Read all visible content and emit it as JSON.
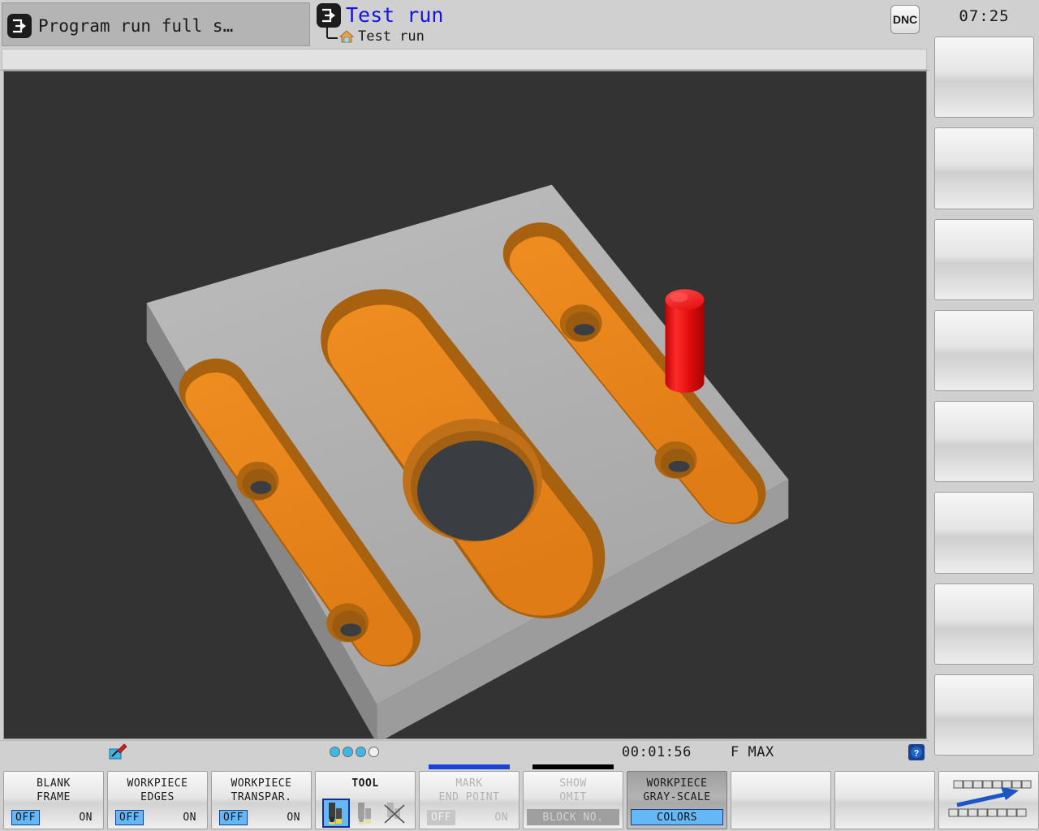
{
  "header": {
    "inactive_tab": {
      "label": "Program run full s…",
      "icon": "mode-enter-icon"
    },
    "active_tab": {
      "label": "Test run",
      "sub_label": "Test run",
      "icon": "mode-enter-icon",
      "sub_icon": "home-icon"
    },
    "dnc_button": "DNC",
    "accent_blue": "#1414e6"
  },
  "clock": {
    "time": "07:25"
  },
  "right_softkeys": [
    {
      "label": "",
      "name": "vertical-softkey-1"
    },
    {
      "label": "",
      "name": "vertical-softkey-2"
    },
    {
      "label": "",
      "name": "vertical-softkey-3"
    },
    {
      "label": "",
      "name": "vertical-softkey-4"
    },
    {
      "label": "",
      "name": "vertical-softkey-5"
    },
    {
      "label": "",
      "name": "vertical-softkey-6"
    },
    {
      "label": "",
      "name": "vertical-softkey-7"
    },
    {
      "label": "",
      "name": "vertical-softkey-8"
    }
  ],
  "graphics": {
    "background_color": "#333333",
    "workpiece_top_color": "#b8b8b8",
    "pocket_color": "#e8871e",
    "pocket_shadow_color": "#b3641a",
    "tool_color": "#e81010",
    "hole_color": "#3a3d42",
    "description": "3D simulated workpiece with three milled slots, drilled holes, central bore and red cylindrical tool"
  },
  "statusbar": {
    "pen_icon": "graphics-pen-icon",
    "dots": [
      "on",
      "on",
      "on",
      "off"
    ],
    "timer": "00:01:56",
    "feed": "F MAX",
    "help_icon": "help-icon"
  },
  "bottom_softkeys": [
    {
      "name": "blank-frame",
      "line1": "BLANK",
      "line2": "FRAME",
      "toggle": {
        "off": "OFF",
        "on": "ON",
        "selected": "off"
      },
      "disabled": false,
      "pressed": false,
      "topbar": "none"
    },
    {
      "name": "workpiece-edges",
      "line1": "WORKPIECE",
      "line2": "EDGES",
      "toggle": {
        "off": "OFF",
        "on": "ON",
        "selected": "off"
      },
      "disabled": false,
      "pressed": false,
      "topbar": "none"
    },
    {
      "name": "workpiece-transparency",
      "line1": "WORKPIECE",
      "line2": "TRANSPAR.",
      "toggle": {
        "off": "OFF",
        "on": "ON",
        "selected": "off"
      },
      "disabled": false,
      "pressed": false,
      "topbar": "none"
    },
    {
      "name": "tool",
      "line1": "TOOL",
      "line2": "",
      "icons": [
        "tool-solid-icon",
        "tool-transparent-icon",
        "tool-off-icon"
      ],
      "selected_icon": 0,
      "disabled": false,
      "pressed": false,
      "topbar": "none"
    },
    {
      "name": "mark-end-point",
      "line1": "MARK",
      "line2": "END POINT",
      "toggle": {
        "off": "OFF",
        "on": "ON",
        "selected": "off"
      },
      "disabled": true,
      "pressed": false,
      "topbar": "blue"
    },
    {
      "name": "show-omit-block-no",
      "line1": "SHOW",
      "line2": "OMIT",
      "wide_label": "BLOCK NO.",
      "disabled": true,
      "pressed": false,
      "topbar": "black"
    },
    {
      "name": "workpiece-gray-scale-colors",
      "line1": "WORKPIECE",
      "line2": "GRAY-SCALE",
      "wide_label": "COLORS",
      "disabled": false,
      "pressed": true,
      "topbar": "none"
    },
    {
      "name": "empty-softkey-1",
      "line1": "",
      "line2": "",
      "disabled": false,
      "pressed": false,
      "topbar": "none"
    },
    {
      "name": "empty-softkey-2",
      "line1": "",
      "line2": "",
      "disabled": false,
      "pressed": false,
      "topbar": "none"
    }
  ],
  "switch_row_key": {
    "name": "switch-softkey-row",
    "icon": "switch-row-arrow-icon"
  }
}
